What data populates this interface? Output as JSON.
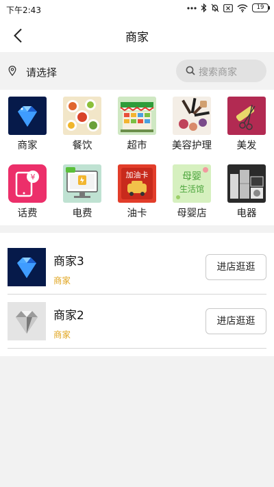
{
  "status_bar": {
    "time": "下午2:43",
    "battery": "19"
  },
  "header": {
    "title": "商家"
  },
  "location": {
    "label": "请选择"
  },
  "search": {
    "placeholder": "搜索商家"
  },
  "categories": [
    {
      "label": "商家",
      "icon": "diamond-icon"
    },
    {
      "label": "餐饮",
      "icon": "food-plates-icon"
    },
    {
      "label": "超市",
      "icon": "supermarket-icon"
    },
    {
      "label": "美容护理",
      "icon": "makeup-brushes-icon"
    },
    {
      "label": "美发",
      "icon": "scissors-comb-icon"
    },
    {
      "label": "话费",
      "icon": "phone-recharge-icon"
    },
    {
      "label": "电费",
      "icon": "electric-bill-icon"
    },
    {
      "label": "油卡",
      "icon": "fuel-card-icon"
    },
    {
      "label": "母婴店",
      "icon": "maternity-store-icon"
    },
    {
      "label": "电器",
      "icon": "appliances-icon"
    }
  ],
  "category_texts": {
    "fuel_card_text": "加油卡",
    "maternity_text_1": "母婴",
    "maternity_text_2": "生活馆",
    "electric_text": "电费"
  },
  "merchants": [
    {
      "name": "商家3",
      "tag": "商家",
      "button": "进店逛逛"
    },
    {
      "name": "商家2",
      "tag": "商家",
      "button": "进店逛逛"
    }
  ]
}
